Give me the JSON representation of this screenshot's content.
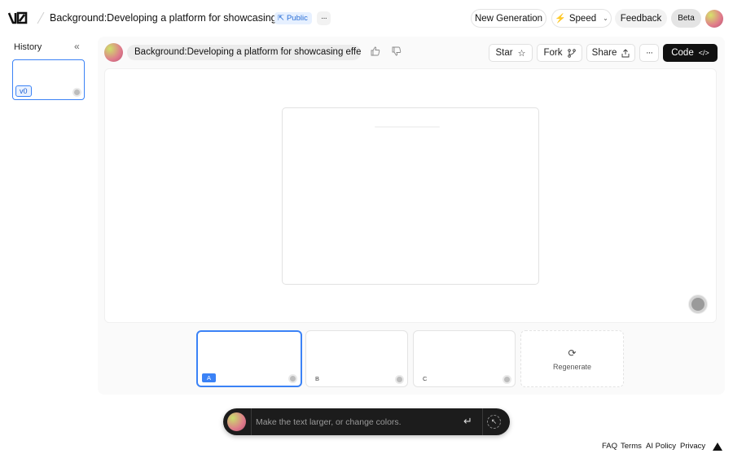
{
  "header": {
    "logo": "v0",
    "title": "Background:Developing a platform for showcasing effec...",
    "visibility": "Public",
    "more": "···",
    "new_generation": "New Generation",
    "speed": "Speed",
    "feedback": "Feedback",
    "beta": "Beta"
  },
  "history": {
    "label": "History",
    "collapse": "«",
    "items": [
      {
        "version": "v0"
      }
    ]
  },
  "toolbar": {
    "prompt": "Background:Developing a platform for showcasing effects...",
    "star": "Star",
    "fork": "Fork",
    "share": "Share",
    "more": "···",
    "code": "Code"
  },
  "variants": [
    {
      "label": "A",
      "selected": true
    },
    {
      "label": "B",
      "selected": false
    },
    {
      "label": "C",
      "selected": false
    }
  ],
  "regenerate": {
    "label": "Regenerate",
    "icon": "refresh-icon"
  },
  "chat": {
    "placeholder": "Make the text larger, or change colors."
  },
  "footer": {
    "faq": "FAQ",
    "terms": "Terms",
    "ai_policy": "AI Policy",
    "privacy": "Privacy"
  },
  "colors": {
    "accent": "#3b82f6",
    "code_button": "#111111",
    "chat_bar": "#1c1c1c"
  }
}
